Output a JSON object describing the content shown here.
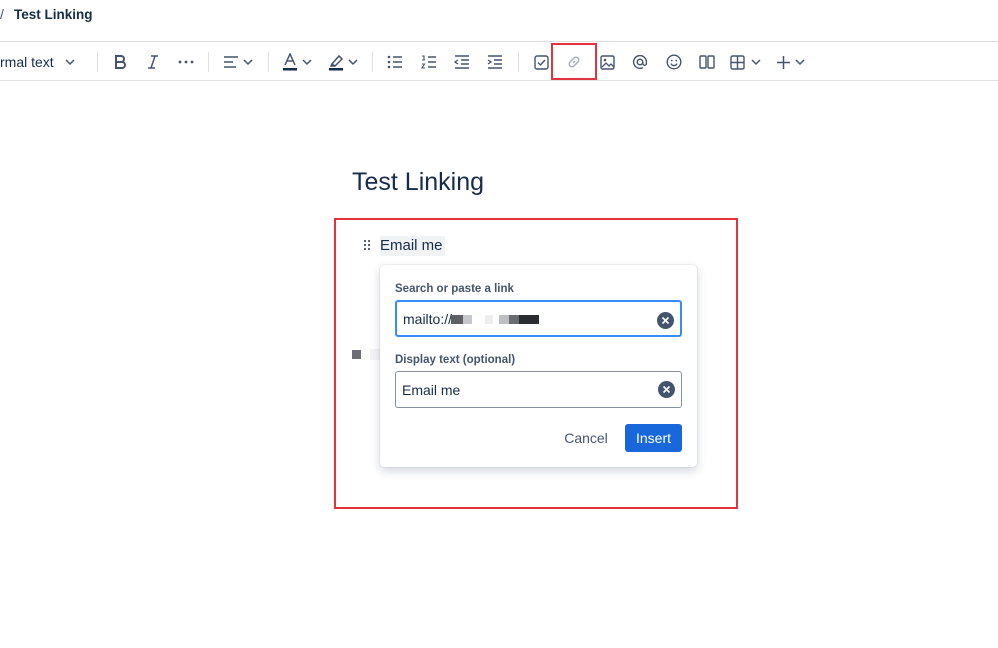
{
  "breadcrumb": {
    "separator": "/",
    "page_title": "Test Linking"
  },
  "toolbar": {
    "text_style": "rmal text",
    "buttons": [
      {
        "icon": "bold-icon"
      },
      {
        "icon": "italic-icon"
      },
      {
        "icon": "more-formatting-icon"
      },
      {
        "icon": "align-left-icon"
      },
      {
        "icon": "text-color-icon"
      },
      {
        "icon": "highlight-icon"
      },
      {
        "icon": "bullet-list-icon"
      },
      {
        "icon": "numbered-list-icon"
      },
      {
        "icon": "outdent-icon"
      },
      {
        "icon": "indent-icon"
      },
      {
        "icon": "action-item-icon"
      },
      {
        "icon": "link-icon"
      },
      {
        "icon": "image-icon"
      },
      {
        "icon": "mention-icon"
      },
      {
        "icon": "emoji-icon"
      },
      {
        "icon": "layouts-icon"
      },
      {
        "icon": "table-icon"
      },
      {
        "icon": "insert-plus-icon"
      }
    ]
  },
  "document": {
    "title": "Test Linking",
    "link_text": "Email me"
  },
  "link_popup": {
    "search_label": "Search or paste a link",
    "search_value": "mailto://",
    "display_label": "Display text (optional)",
    "display_value": "Email me",
    "cancel_label": "Cancel",
    "insert_label": "Insert"
  },
  "colors": {
    "highlight_red": "#e5323f",
    "primary_blue": "#1868db",
    "focus_blue": "#388bff",
    "text": "#172b4d"
  }
}
